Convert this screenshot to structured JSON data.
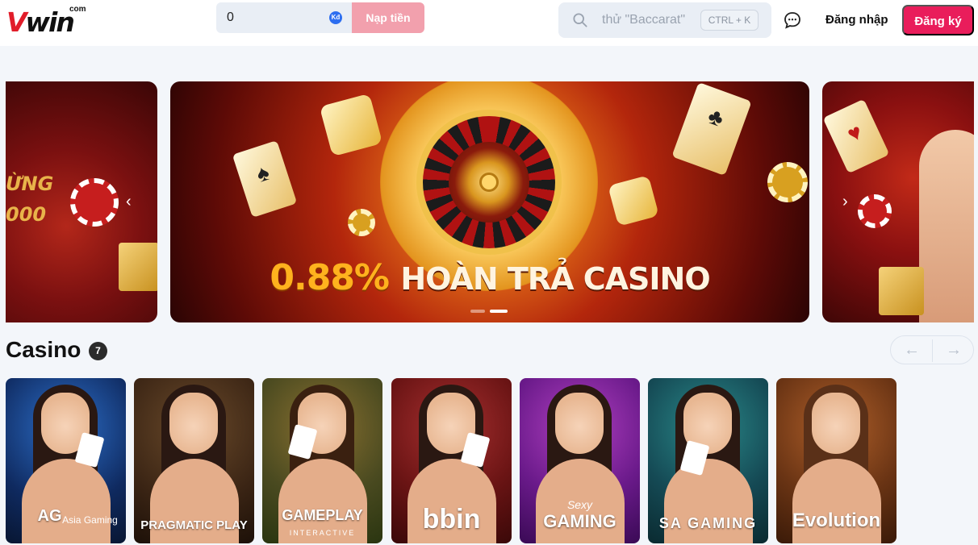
{
  "header": {
    "logo_main": "Vwin",
    "logo_com": "com",
    "balance_value": "0",
    "currency_badge": "Kđ",
    "deposit_label": "Nạp tiền",
    "search_placeholder": "thử \"Baccarat\"",
    "search_shortcut": "CTRL + K",
    "login_label": "Đăng nhập",
    "register_label": "Đăng ký"
  },
  "banner": {
    "left_text_1": "ỪNG",
    "left_text_2": "000",
    "promo_percent": "0.88%",
    "promo_text": "HOÀN TRẢ CASINO",
    "slide_count": 2,
    "active_slide": 2
  },
  "casino": {
    "title": "Casino",
    "count": "7",
    "providers": [
      {
        "name": "AG",
        "sub": "Asia Gaming"
      },
      {
        "name": "PRAGMATIC PLAY",
        "sub": ""
      },
      {
        "name": "GAMEPLAY",
        "sub": "INTERACTIVE"
      },
      {
        "name": "bbin",
        "sub": ""
      },
      {
        "name": "GAMING",
        "sub": "Sexy"
      },
      {
        "name": "SA GAMING",
        "sub": ""
      },
      {
        "name": "Evolution",
        "sub": ""
      }
    ]
  },
  "colors": {
    "brand_red": "#e91d5b",
    "deposit_pink": "#f2a0ad",
    "logo_red": "#e11d2a"
  }
}
